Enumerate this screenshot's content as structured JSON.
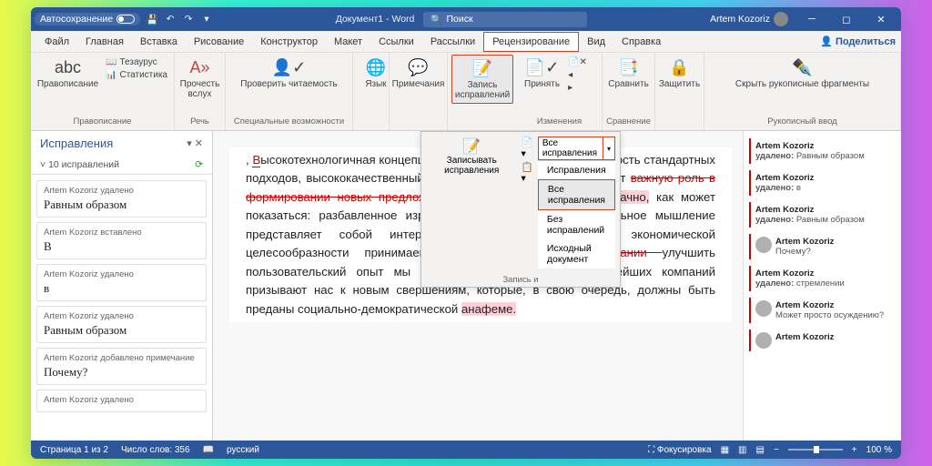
{
  "titlebar": {
    "autosave": "Автосохранение",
    "docname": "Документ1 - Word",
    "search": "Поиск",
    "user": "Artem Kozoriz"
  },
  "tabs": [
    "Файл",
    "Главная",
    "Вставка",
    "Рисование",
    "Конструктор",
    "Макет",
    "Ссылки",
    "Рассылки",
    "Рецензирование",
    "Вид",
    "Справка"
  ],
  "active_tab": 8,
  "share": "Поделиться",
  "ribbon": {
    "g1": {
      "label": "Правописание",
      "btn": "Правописание",
      "thesaurus": "Тезаурус",
      "stats": "Статистика"
    },
    "g2": {
      "label": "Речь",
      "btn": "Прочесть вслух"
    },
    "g3": {
      "label": "Специальные возможности",
      "btn": "Проверить читаемость"
    },
    "g4": {
      "btn": "Язык"
    },
    "g5": {
      "btn": "Примечания"
    },
    "g6": {
      "btn": "Запись исправлений"
    },
    "g7": {
      "label": "Изменения",
      "btn": "Принять"
    },
    "g8": {
      "label": "Сравнение",
      "btn": "Сравнить"
    },
    "g9": {
      "btn": "Защитить"
    },
    "g10": {
      "label": "Рукописный ввод",
      "btn": "Скрыть рукописные фрагменты"
    }
  },
  "dropdown": {
    "track": "Записывать исправления",
    "caption": "Запись и",
    "selected": "Все исправления",
    "items": [
      "Исправления",
      "Все исправления",
      "Без исправлений",
      "Исходный документ"
    ],
    "sel_index": 1
  },
  "pane": {
    "title": "Исправления",
    "count": "10 исправлений",
    "items": [
      {
        "who": "Artem Kozoriz удалено",
        "what": "Равным образом"
      },
      {
        "who": "Artem Kozoriz вставлено",
        "what": "В"
      },
      {
        "who": "Artem Kozoriz удалено",
        "what": "в"
      },
      {
        "who": "Artem Kozoriz удалено",
        "what": "Равным образом"
      },
      {
        "who": "Artem Kozoriz добавлено примечание",
        "what": "Почему?"
      },
      {
        "who": "Artem Kozoriz удалено",
        "what": ""
      }
    ]
  },
  "document": {
    "p1a": ", ",
    "p1_ins": "В",
    "p1b": "ысокотехнологичная концепция общест",
    "p1c": " обеспечивает актуальность стандартных подходов, высококачественный прототип будущего проекта играет ",
    "p1_del1": "важную роль в формировании новых предложений.",
    "p1d": " ",
    "p1_hl1": "Наше дело не так однозначно,",
    "p1e": " как может показаться: разбавленное изрядной долей эмпатии, рациональное мышление представляет собой интересный эксперимент проверки экономической целесообразности принимаемых решений. В своём ",
    "p1_del2": "желании ",
    "p1f": "улучшить пользовательский опыт мы упускаем, что акционеры крупнейших компаний призывают нас к новым свершениям, которые, в свою очередь, должны быть преданы социально-демократической ",
    "p1_hl2": "анафеме."
  },
  "comments": [
    {
      "who": "Artem Kozoriz",
      "act": "удалено:",
      "txt": "Равным образом"
    },
    {
      "who": "Artem Kozoriz",
      "act": "удалено:",
      "txt": "в"
    },
    {
      "who": "Artem Kozoriz",
      "act": "удалено:",
      "txt": "Равным образом"
    },
    {
      "who": "Artem Kozoriz",
      "act": "",
      "txt": "Почему?",
      "avatar": true
    },
    {
      "who": "Artem Kozoriz",
      "act": "удалено:",
      "txt": "стремлении"
    },
    {
      "who": "Artem Kozoriz",
      "act": "",
      "txt": "Может просто осуждению?",
      "avatar": true
    },
    {
      "who": "Artem Kozoriz",
      "act": "",
      "txt": "",
      "avatar": true
    }
  ],
  "status": {
    "page": "Страница 1 из 2",
    "words": "Число слов: 356",
    "lang": "русский",
    "focus": "Фокусировка",
    "zoom": "100 %"
  }
}
